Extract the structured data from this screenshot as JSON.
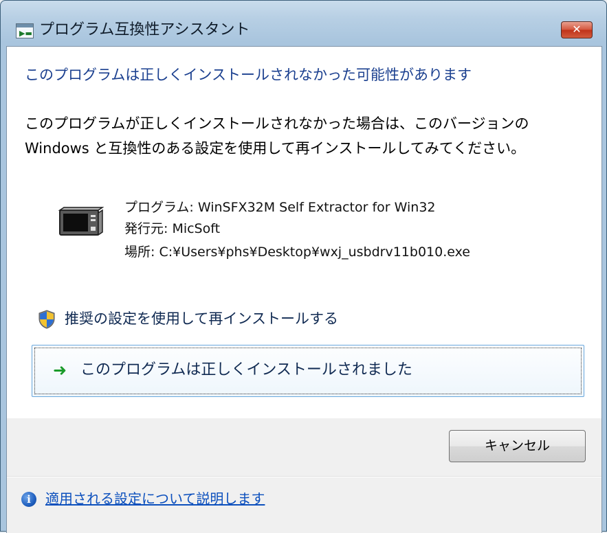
{
  "window": {
    "title": "プログラム互換性アシスタント",
    "close_label": "✕"
  },
  "content": {
    "instruction": "このプログラムは正しくインストールされなかった可能性があります",
    "message": "このプログラムが正しくインストールされなかった場合は、このバージョンの Windows と互換性のある設定を使用して再インストールしてみてください。",
    "program_line": "プログラム: WinSFX32M Self Extractor for Win32",
    "publisher_line": "発行元: MicSoft",
    "location_line": "場所: C:¥Users¥phs¥Desktop¥wxj_usbdrv11b010.exe"
  },
  "options": {
    "reinstall_recommended": "推奨の設定を使用して再インストールする",
    "installed_correctly": "このプログラムは正しくインストールされました"
  },
  "buttons": {
    "cancel": "キャンセル"
  },
  "footer": {
    "link": "適用される設定について説明します"
  },
  "icons": {
    "app": "compatibility-assistant-icon",
    "program": "program-icon",
    "shield": "uac-shield-icon",
    "arrow": "green-arrow-icon",
    "info": "info-icon"
  },
  "colors": {
    "instruction": "#1a3f8f",
    "link": "#0b4fbd",
    "arrow": "#1a9b2a",
    "close": "#d4553c"
  }
}
